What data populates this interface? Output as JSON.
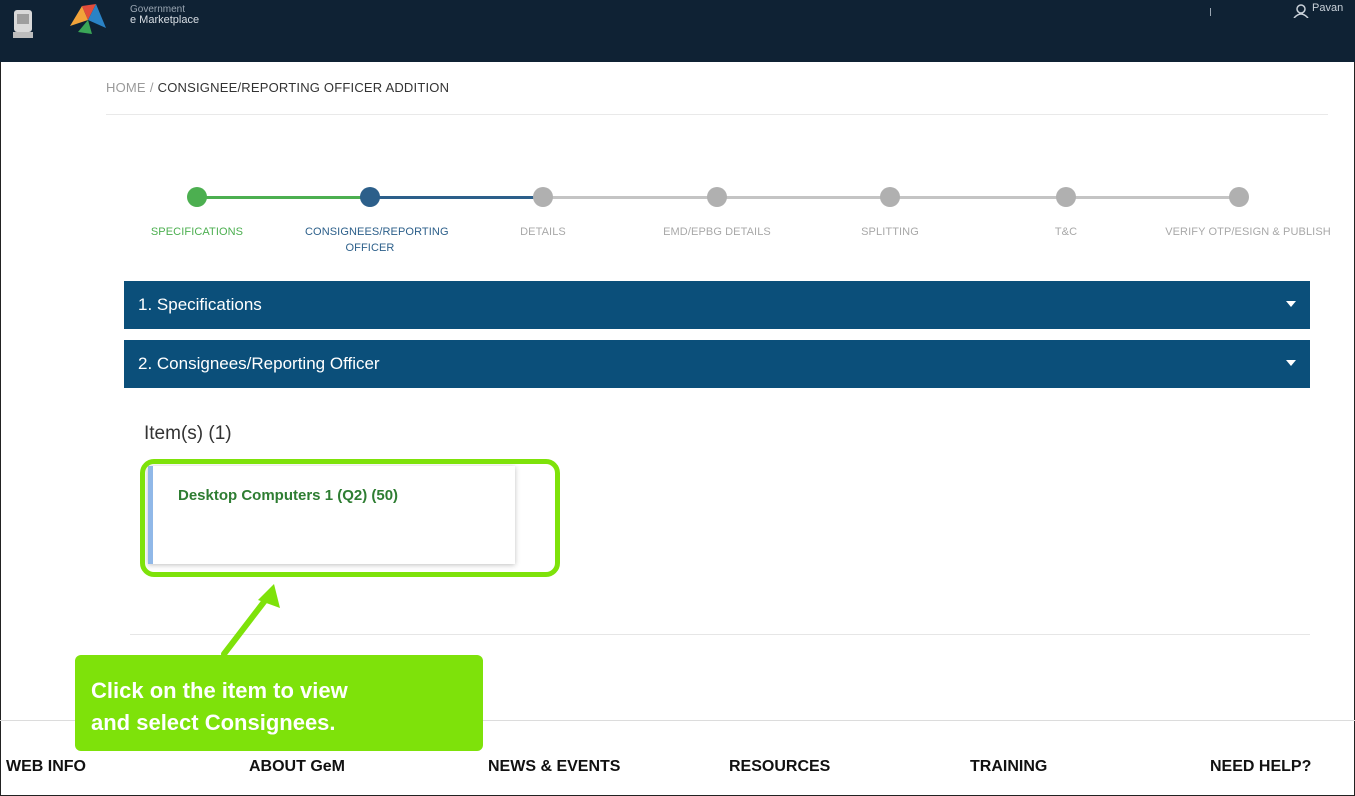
{
  "header": {
    "brand_line1": "Government",
    "brand_line2": "e Marketplace",
    "user_name": "Pavan"
  },
  "breadcrumb": {
    "home": "HOME",
    "separator": "/",
    "current": "CONSIGNEE/REPORTING OFFICER ADDITION"
  },
  "steps": [
    {
      "label": "SPECIFICATIONS",
      "state": "done"
    },
    {
      "label": "CONSIGNEES/REPORTING OFFICER",
      "state": "active"
    },
    {
      "label": "DETAILS",
      "state": "pending"
    },
    {
      "label": "EMD/EPBG DETAILS",
      "state": "pending"
    },
    {
      "label": "SPLITTING",
      "state": "pending"
    },
    {
      "label": "T&C",
      "state": "pending"
    },
    {
      "label": "VERIFY OTP/ESIGN & PUBLISH",
      "state": "pending"
    }
  ],
  "accordions": [
    {
      "title": "1. Specifications"
    },
    {
      "title": "2. Consignees/Reporting Officer"
    }
  ],
  "items": {
    "title": "Item(s) (1)",
    "list": [
      {
        "name": "Desktop Computers 1  (Q2)  (50)"
      }
    ]
  },
  "callout": {
    "line1": "Click on the item to view",
    "line2": "and select Consignees."
  },
  "footer": [
    "WEB INFO",
    "ABOUT GeM",
    "NEWS & EVENTS",
    "RESOURCES",
    "TRAINING",
    "NEED HELP?"
  ],
  "colors": {
    "topbar": "#0f2234",
    "accordion": "#0b4f7a",
    "step_done": "#4caf50",
    "step_active": "#2c5f8a",
    "step_pending": "#b0b0b0",
    "highlight": "#7ee20a",
    "item_text": "#2e7d32"
  }
}
